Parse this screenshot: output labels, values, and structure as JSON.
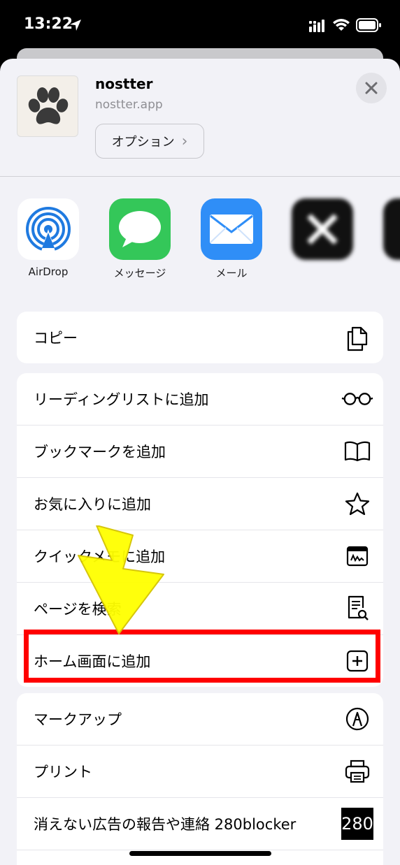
{
  "status_bar": {
    "time": "13:22"
  },
  "header": {
    "title": "nostter",
    "subtitle": "nostter.app",
    "options_label": "オプション",
    "options_chevron": "›"
  },
  "apps": [
    {
      "label": "AirDrop",
      "icon": "airdrop-icon"
    },
    {
      "label": "メッセージ",
      "icon": "messages-icon"
    },
    {
      "label": "メール",
      "icon": "mail-icon"
    },
    {
      "label": "",
      "icon": "x-app-icon"
    },
    {
      "label": "",
      "icon": "app-icon"
    }
  ],
  "groups": [
    {
      "rows": [
        {
          "label": "コピー",
          "icon": "copy-icon"
        }
      ]
    },
    {
      "rows": [
        {
          "label": "リーディングリストに追加",
          "icon": "glasses-icon"
        },
        {
          "label": "ブックマークを追加",
          "icon": "book-icon"
        },
        {
          "label": "お気に入りに追加",
          "icon": "star-icon"
        },
        {
          "label": "クイックメモに追加",
          "icon": "quick-note-icon"
        },
        {
          "label": "ページを検索",
          "icon": "find-on-page-icon"
        },
        {
          "label": "ホーム画面に追加",
          "icon": "add-square-icon"
        }
      ]
    },
    {
      "rows": [
        {
          "label": "マークアップ",
          "icon": "markup-icon"
        },
        {
          "label": "プリント",
          "icon": "printer-icon"
        },
        {
          "label": "消えない広告の報告や連絡 280blocker",
          "icon": "280blocker-icon",
          "badge": "280"
        }
      ]
    }
  ],
  "colors": {
    "highlight": "#ff0000",
    "arrow": "#ffff00"
  }
}
